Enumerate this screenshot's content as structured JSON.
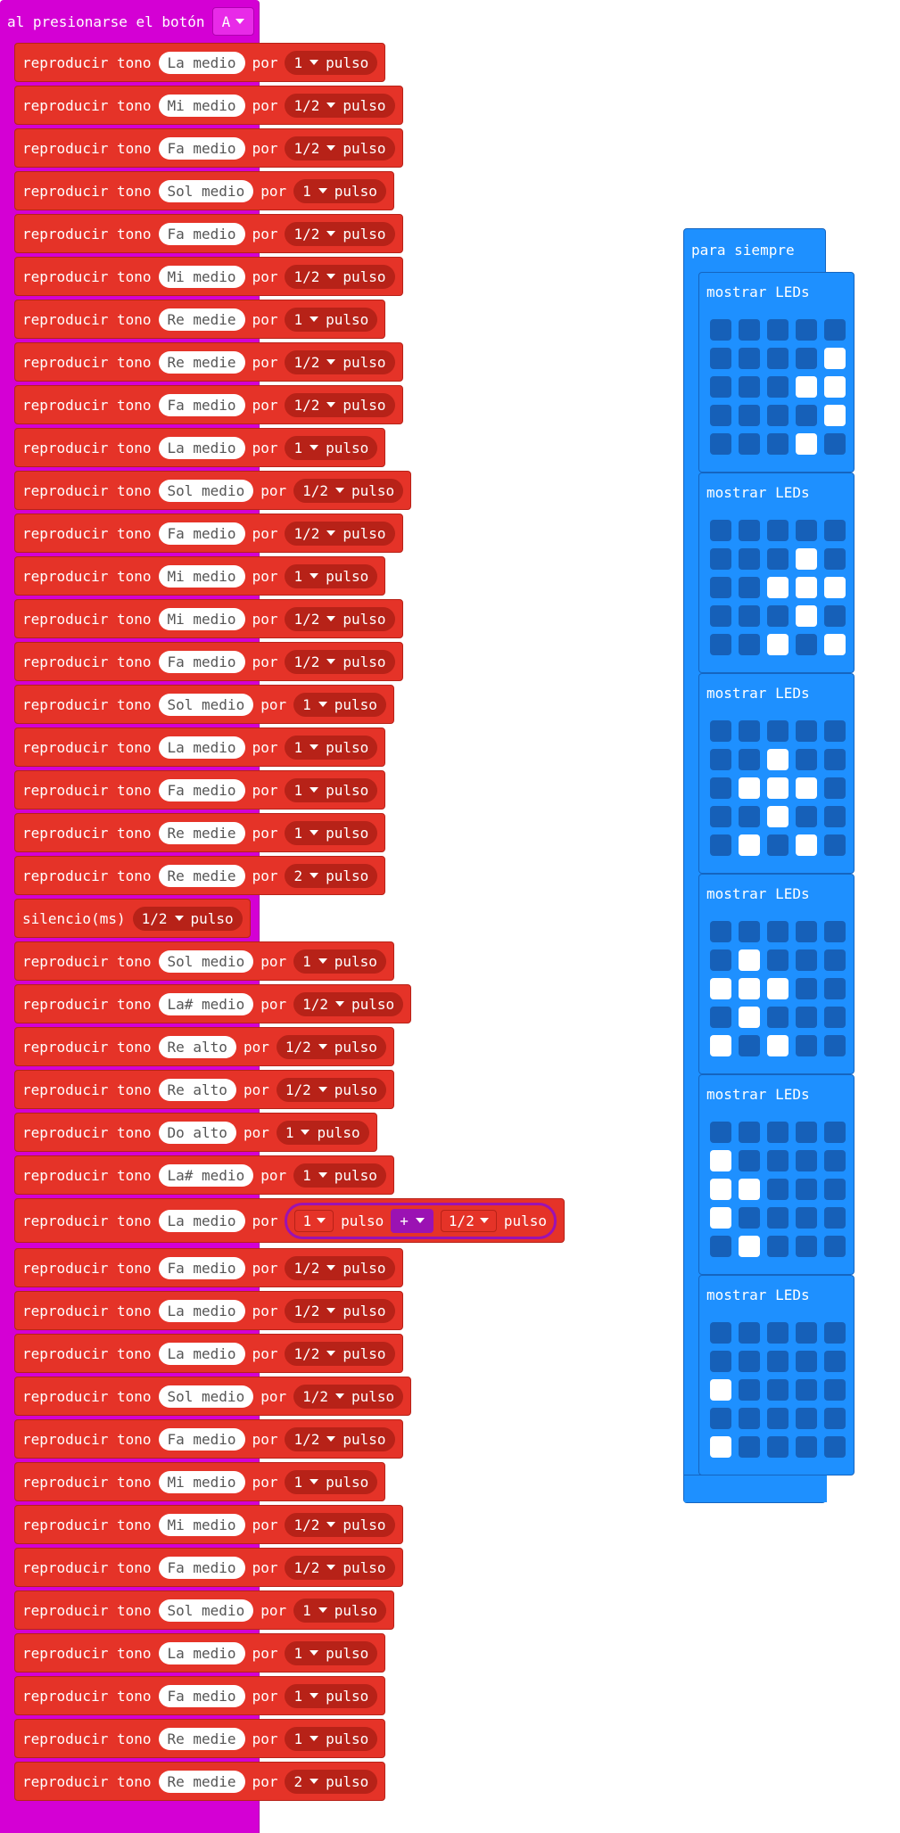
{
  "event": {
    "label": "al presionarse el botón",
    "button_value": "A"
  },
  "rows": [
    {
      "type": "tone",
      "label": "reproducir tono",
      "note": "La medio",
      "por": "por",
      "beat": "1",
      "unit": "pulso"
    },
    {
      "type": "tone",
      "label": "reproducir tono",
      "note": "Mi medio",
      "por": "por",
      "beat": "1/2",
      "unit": "pulso"
    },
    {
      "type": "tone",
      "label": "reproducir tono",
      "note": "Fa medio",
      "por": "por",
      "beat": "1/2",
      "unit": "pulso"
    },
    {
      "type": "tone",
      "label": "reproducir tono",
      "note": "Sol medio",
      "por": "por",
      "beat": "1",
      "unit": "pulso"
    },
    {
      "type": "tone",
      "label": "reproducir tono",
      "note": "Fa medio",
      "por": "por",
      "beat": "1/2",
      "unit": "pulso"
    },
    {
      "type": "tone",
      "label": "reproducir tono",
      "note": "Mi medio",
      "por": "por",
      "beat": "1/2",
      "unit": "pulso"
    },
    {
      "type": "tone",
      "label": "reproducir tono",
      "note": "Re medie",
      "por": "por",
      "beat": "1",
      "unit": "pulso"
    },
    {
      "type": "tone",
      "label": "reproducir tono",
      "note": "Re medie",
      "por": "por",
      "beat": "1/2",
      "unit": "pulso"
    },
    {
      "type": "tone",
      "label": "reproducir tono",
      "note": "Fa medio",
      "por": "por",
      "beat": "1/2",
      "unit": "pulso"
    },
    {
      "type": "tone",
      "label": "reproducir tono",
      "note": "La medio",
      "por": "por",
      "beat": "1",
      "unit": "pulso"
    },
    {
      "type": "tone",
      "label": "reproducir tono",
      "note": "Sol medio",
      "por": "por",
      "beat": "1/2",
      "unit": "pulso"
    },
    {
      "type": "tone",
      "label": "reproducir tono",
      "note": "Fa medio",
      "por": "por",
      "beat": "1/2",
      "unit": "pulso"
    },
    {
      "type": "tone",
      "label": "reproducir tono",
      "note": "Mi medio",
      "por": "por",
      "beat": "1",
      "unit": "pulso"
    },
    {
      "type": "tone",
      "label": "reproducir tono",
      "note": "Mi medio",
      "por": "por",
      "beat": "1/2",
      "unit": "pulso"
    },
    {
      "type": "tone",
      "label": "reproducir tono",
      "note": "Fa medio",
      "por": "por",
      "beat": "1/2",
      "unit": "pulso"
    },
    {
      "type": "tone",
      "label": "reproducir tono",
      "note": "Sol medio",
      "por": "por",
      "beat": "1",
      "unit": "pulso"
    },
    {
      "type": "tone",
      "label": "reproducir tono",
      "note": "La medio",
      "por": "por",
      "beat": "1",
      "unit": "pulso"
    },
    {
      "type": "tone",
      "label": "reproducir tono",
      "note": "Fa medio",
      "por": "por",
      "beat": "1",
      "unit": "pulso"
    },
    {
      "type": "tone",
      "label": "reproducir tono",
      "note": "Re medie",
      "por": "por",
      "beat": "1",
      "unit": "pulso"
    },
    {
      "type": "tone",
      "label": "reproducir tono",
      "note": "Re medie",
      "por": "por",
      "beat": "2",
      "unit": "pulso"
    },
    {
      "type": "rest",
      "label": "silencio(ms)",
      "beat": "1/2",
      "unit": "pulso"
    },
    {
      "type": "tone",
      "label": "reproducir tono",
      "note": "Sol medio",
      "por": "por",
      "beat": "1",
      "unit": "pulso"
    },
    {
      "type": "tone",
      "label": "reproducir tono",
      "note": "La# medio",
      "por": "por",
      "beat": "1/2",
      "unit": "pulso"
    },
    {
      "type": "tone",
      "label": "reproducir tono",
      "note": "Re alto",
      "por": "por",
      "beat": "1/2",
      "unit": "pulso"
    },
    {
      "type": "tone",
      "label": "reproducir tono",
      "note": "Re alto",
      "por": "por",
      "beat": "1/2",
      "unit": "pulso"
    },
    {
      "type": "tone",
      "label": "reproducir tono",
      "note": "Do alto",
      "por": "por",
      "beat": "1",
      "unit": "pulso"
    },
    {
      "type": "tone",
      "label": "reproducir tono",
      "note": "La# medio",
      "por": "por",
      "beat": "1",
      "unit": "pulso"
    },
    {
      "type": "expr",
      "label": "reproducir tono",
      "note": "La medio",
      "por": "por",
      "a": "1",
      "unit_a": "pulso",
      "op": "+",
      "b": "1/2",
      "unit_b": "pulso"
    },
    {
      "type": "tone",
      "label": "reproducir tono",
      "note": "Fa medio",
      "por": "por",
      "beat": "1/2",
      "unit": "pulso"
    },
    {
      "type": "tone",
      "label": "reproducir tono",
      "note": "La medio",
      "por": "por",
      "beat": "1/2",
      "unit": "pulso"
    },
    {
      "type": "tone",
      "label": "reproducir tono",
      "note": "La medio",
      "por": "por",
      "beat": "1/2",
      "unit": "pulso"
    },
    {
      "type": "tone",
      "label": "reproducir tono",
      "note": "Sol medio",
      "por": "por",
      "beat": "1/2",
      "unit": "pulso"
    },
    {
      "type": "tone",
      "label": "reproducir tono",
      "note": "Fa medio",
      "por": "por",
      "beat": "1/2",
      "unit": "pulso"
    },
    {
      "type": "tone",
      "label": "reproducir tono",
      "note": "Mi medio",
      "por": "por",
      "beat": "1",
      "unit": "pulso"
    },
    {
      "type": "tone",
      "label": "reproducir tono",
      "note": "Mi medio",
      "por": "por",
      "beat": "1/2",
      "unit": "pulso"
    },
    {
      "type": "tone",
      "label": "reproducir tono",
      "note": "Fa medio",
      "por": "por",
      "beat": "1/2",
      "unit": "pulso"
    },
    {
      "type": "tone",
      "label": "reproducir tono",
      "note": "Sol medio",
      "por": "por",
      "beat": "1",
      "unit": "pulso"
    },
    {
      "type": "tone",
      "label": "reproducir tono",
      "note": "La medio",
      "por": "por",
      "beat": "1",
      "unit": "pulso"
    },
    {
      "type": "tone",
      "label": "reproducir tono",
      "note": "Fa medio",
      "por": "por",
      "beat": "1",
      "unit": "pulso"
    },
    {
      "type": "tone",
      "label": "reproducir tono",
      "note": "Re medie",
      "por": "por",
      "beat": "1",
      "unit": "pulso"
    },
    {
      "type": "tone",
      "label": "reproducir tono",
      "note": "Re medie",
      "por": "por",
      "beat": "2",
      "unit": "pulso"
    }
  ],
  "forever": {
    "title": "para siempre",
    "led_label": "mostrar LEDs",
    "frames": [
      {
        "on": [
          [
            1,
            4
          ],
          [
            2,
            3
          ],
          [
            2,
            4
          ],
          [
            3,
            4
          ],
          [
            4,
            3
          ]
        ]
      },
      {
        "on": [
          [
            1,
            3
          ],
          [
            2,
            2
          ],
          [
            2,
            3
          ],
          [
            2,
            4
          ],
          [
            3,
            3
          ],
          [
            4,
            2
          ],
          [
            4,
            4
          ]
        ]
      },
      {
        "on": [
          [
            1,
            2
          ],
          [
            2,
            1
          ],
          [
            2,
            2
          ],
          [
            2,
            3
          ],
          [
            3,
            2
          ],
          [
            4,
            1
          ],
          [
            4,
            3
          ]
        ]
      },
      {
        "on": [
          [
            1,
            1
          ],
          [
            2,
            0
          ],
          [
            2,
            1
          ],
          [
            2,
            2
          ],
          [
            3,
            1
          ],
          [
            4,
            0
          ],
          [
            4,
            2
          ]
        ]
      },
      {
        "on": [
          [
            1,
            0
          ],
          [
            2,
            0
          ],
          [
            2,
            1
          ],
          [
            3,
            0
          ],
          [
            4,
            1
          ]
        ]
      },
      {
        "on": [
          [
            2,
            0
          ],
          [
            4,
            0
          ]
        ]
      }
    ]
  }
}
